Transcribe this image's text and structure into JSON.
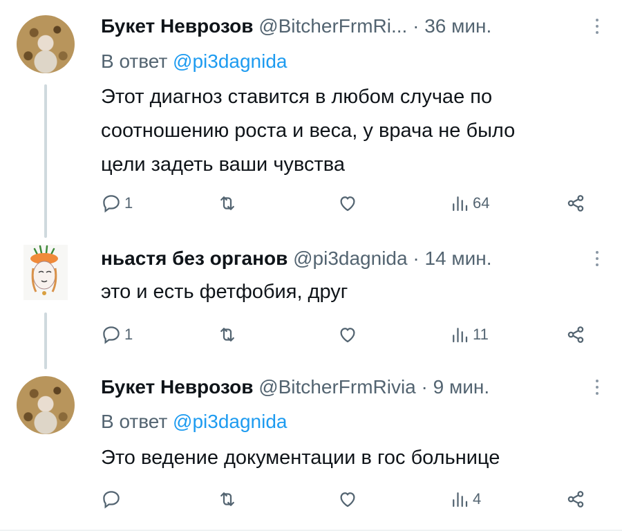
{
  "tweets": [
    {
      "author": "Букет Неврозов",
      "handle": "@BitcherFrmRi...",
      "separator": "·",
      "time": "36 мин.",
      "reply_prefix": "В ответ",
      "reply_to": "@pi3dagnida",
      "text_lines": [
        "Этот диагноз ставится в любом случае по",
        "соотношению роста и веса, у врача не было",
        "цели задеть ваши чувства"
      ],
      "replies": "1",
      "views": "64",
      "avatar_icon": "avatar-photo-icon"
    },
    {
      "author": "ньастя без органов",
      "handle": "@pi3dagnida",
      "separator": "·",
      "time": "14 мин.",
      "text_lines": [
        "это и есть фетфобия, друг"
      ],
      "replies": "1",
      "views": "11",
      "avatar_icon": "avatar-drawing-icon"
    },
    {
      "author": "Букет Неврозов",
      "handle": "@BitcherFrmRivia",
      "separator": "·",
      "time": "9 мин.",
      "reply_prefix": "В ответ",
      "reply_to": "@pi3dagnida",
      "text_lines": [
        "Это ведение документации в гос больнице"
      ],
      "replies": "",
      "views": "4",
      "avatar_icon": "avatar-photo-icon"
    }
  ],
  "colors": {
    "text": "#0f1419",
    "secondary": "#536471",
    "link": "#1d9bf0",
    "thread_line": "#cfd9de"
  },
  "icons": [
    "reply-icon",
    "retweet-icon",
    "like-icon",
    "views-icon",
    "share-icon",
    "more-icon"
  ]
}
